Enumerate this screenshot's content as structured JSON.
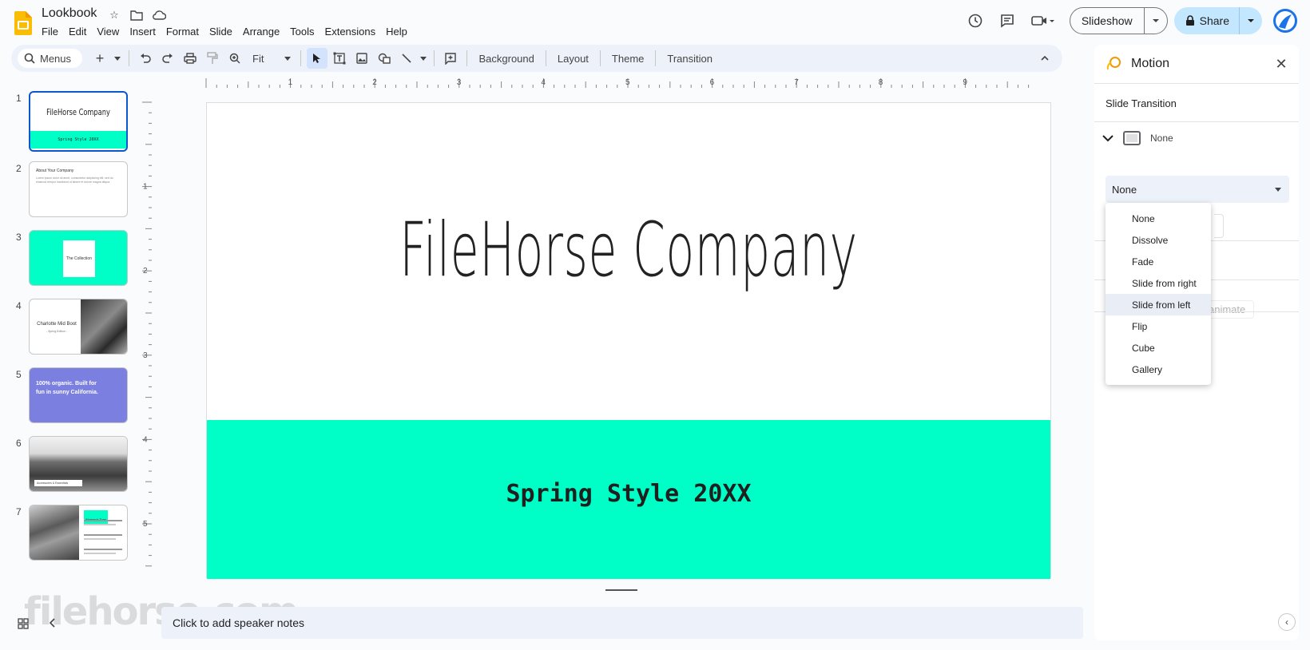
{
  "app": {
    "doc_title": "Lookbook",
    "menus": [
      "File",
      "Edit",
      "View",
      "Insert",
      "Format",
      "Slide",
      "Arrange",
      "Tools",
      "Extensions",
      "Help"
    ]
  },
  "header": {
    "slideshow_label": "Slideshow",
    "share_label": "Share"
  },
  "toolbar": {
    "search_label": "Menus",
    "zoom_value": "Fit",
    "background_label": "Background",
    "layout_label": "Layout",
    "theme_label": "Theme",
    "transition_label": "Transition"
  },
  "filmstrip": {
    "numbers": [
      "1",
      "2",
      "3",
      "4",
      "5",
      "6",
      "7"
    ],
    "slide1_title": "FileHorse Company",
    "slide1_sub": "Spring Style 20XX",
    "slide2_title": "About Your Company",
    "slide2_body": "Lorem ipsum dolor sit amet, consectetur adipiscing elit, sed do eiusmod tempor incididunt ut labore et dolore magna aliqua.",
    "slide3_title": "The Collection",
    "slide4_title": "Charlotte Mid Boot",
    "slide4_sub": "- Spring Edition -",
    "slide5_text": "100% organic. Built for fun in sunny California.",
    "slide6_caption": "Accessories & Essentials",
    "slide7_title": "Women's Tops"
  },
  "ruler": {
    "top_ticks": [
      "1",
      "2",
      "3",
      "4",
      "5",
      "6",
      "7",
      "8",
      "9"
    ],
    "left_ticks": [
      "1",
      "2",
      "3",
      "4",
      "5"
    ]
  },
  "slide": {
    "title": "FileHorse Company",
    "subtitle": "Spring Style 20XX",
    "band_color": "#00ffc6"
  },
  "notes": {
    "placeholder": "Click to add speaker notes"
  },
  "watermark": "filehorse.com",
  "motion_panel": {
    "title": "Motion",
    "section_title": "Slide Transition",
    "current_transition": "None",
    "select_value": "None",
    "options": [
      "None",
      "Dissolve",
      "Fade",
      "Slide from right",
      "Slide from left",
      "Flip",
      "Cube",
      "Gallery"
    ],
    "highlighted_option": "Slide from left",
    "faded_animate": "animate"
  },
  "colors": {
    "accent": "#0b57d0",
    "share_bg": "#c2e7ff",
    "logo_yellow": "#fbbc04"
  }
}
